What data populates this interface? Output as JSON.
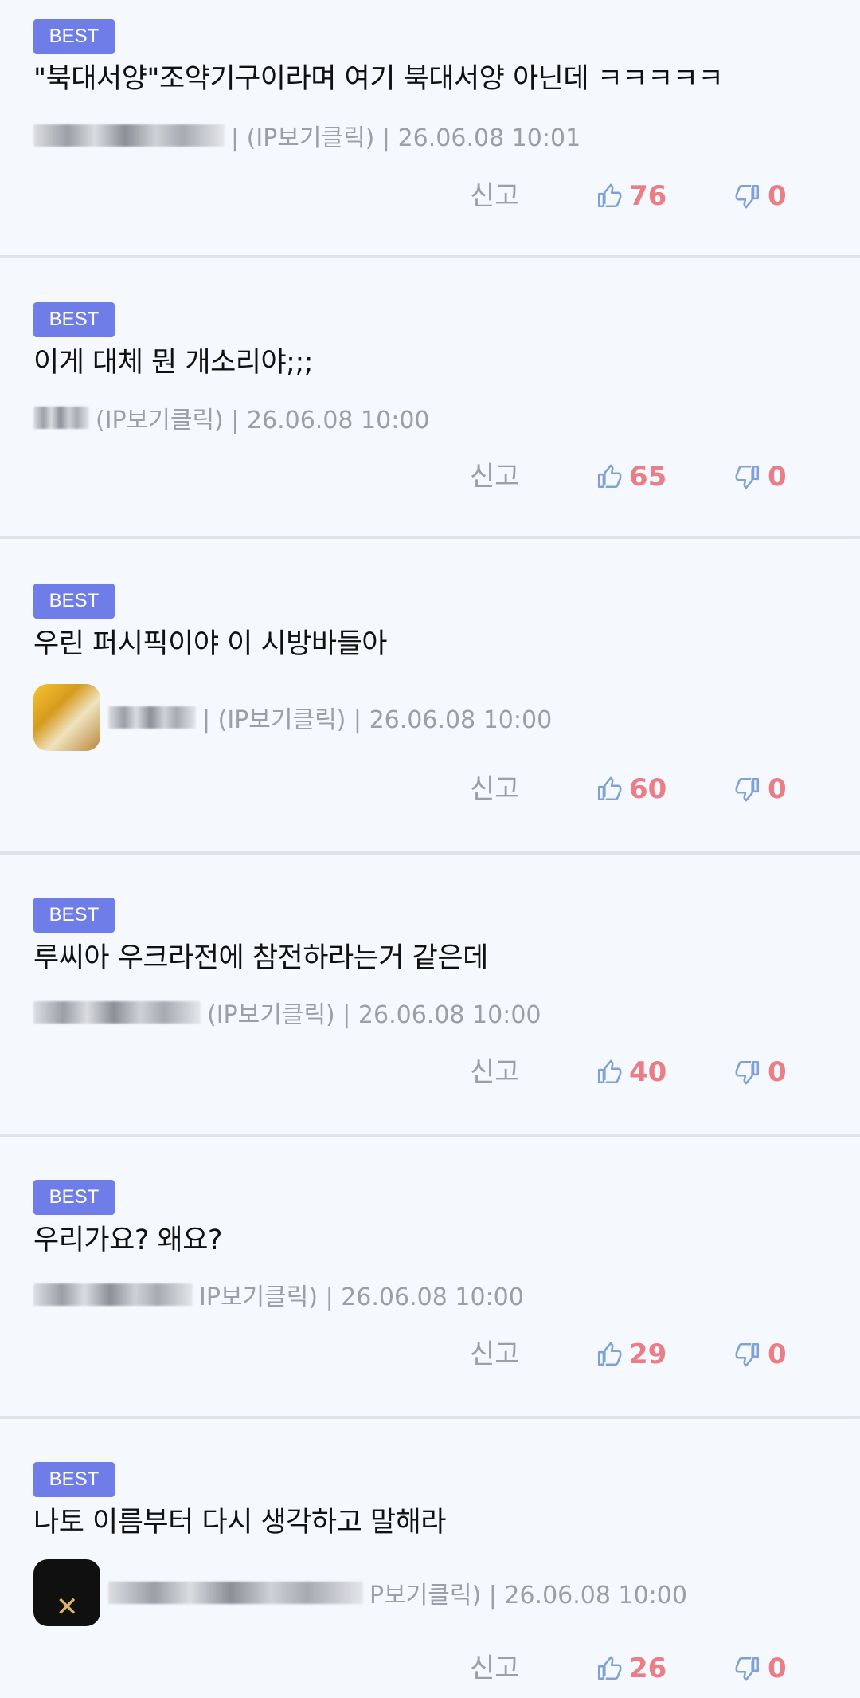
{
  "colors": {
    "background": "#f5f8fd",
    "badge": "#6f7de8",
    "count": "#ea7e86",
    "meta": "#9aa0a8",
    "thumb_icon": "#7fa2d6"
  },
  "comments": [
    {
      "badge": "BEST",
      "text": "\"북대서양\"조약기구이라며 여기 북대서양 아닌데 ㅋㅋㅋㅋㅋ",
      "author_info": "| (IP보기클릭) | 26.06.08 10:01",
      "report_label": "신고",
      "likes": "76",
      "dislikes": "0"
    },
    {
      "badge": "BEST",
      "text": "이게 대체 뭔 개소리야;;;",
      "author_info": "(IP보기클릭) | 26.06.08 10:00",
      "report_label": "신고",
      "likes": "65",
      "dislikes": "0"
    },
    {
      "badge": "BEST",
      "text": "우린 퍼시픽이야 이 시방바들아",
      "author_info": "| (IP보기클릭) | 26.06.08 10:00",
      "report_label": "신고",
      "likes": "60",
      "dislikes": "0"
    },
    {
      "badge": "BEST",
      "text": "루씨아 우크라전에 참전하라는거 같은데",
      "author_info": "(IP보기클릭) | 26.06.08 10:00",
      "report_label": "신고",
      "likes": "40",
      "dislikes": "0"
    },
    {
      "badge": "BEST",
      "text": "우리가요? 왜요?",
      "author_info": "IP보기클릭) | 26.06.08 10:00",
      "report_label": "신고",
      "likes": "29",
      "dislikes": "0"
    },
    {
      "badge": "BEST",
      "text": "나토 이름부터 다시 생각하고 말해라",
      "author_info": "P보기클릭) | 26.06.08 10:00",
      "report_label": "신고",
      "likes": "26",
      "dislikes": "0"
    }
  ]
}
